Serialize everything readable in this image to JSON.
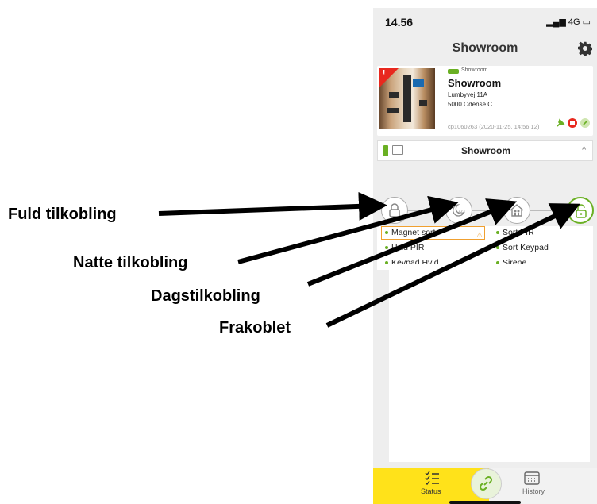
{
  "status_bar": {
    "time": "14.56",
    "network": "4G"
  },
  "header": {
    "title": "Showroom"
  },
  "site_card": {
    "badge_label": "Showroom",
    "name": "Showroom",
    "address_line1": "Lumbyvej 11A",
    "address_line2": "5000 Odense C",
    "panel_id": "cp1060263 (2020-11-25, 14:56:12)",
    "alert_mark": "!"
  },
  "area_panel": {
    "title": "Showroom"
  },
  "arm_modes": [
    {
      "name": "full-arm",
      "active": false
    },
    {
      "name": "night-arm",
      "active": false
    },
    {
      "name": "day-arm",
      "active": false
    },
    {
      "name": "disarmed",
      "active": true
    }
  ],
  "devices": {
    "left": [
      "Magnet sort",
      "Hvid PIR",
      "Keypad Hvid"
    ],
    "right": [
      "Sort PIR",
      "Sort Keypad",
      "Sirene"
    ]
  },
  "tabs": {
    "status_label": "Status",
    "history_label": "History"
  },
  "annotations": {
    "full": "Fuld tilkobling",
    "night": "Natte tilkobling",
    "day": "Dagstilkobling",
    "off": "Frakoblet"
  },
  "colors": {
    "accent_green": "#6ab023",
    "tab_yellow": "#ffe21a",
    "alert_red": "#e8281e",
    "warning_orange": "#f0a030"
  }
}
